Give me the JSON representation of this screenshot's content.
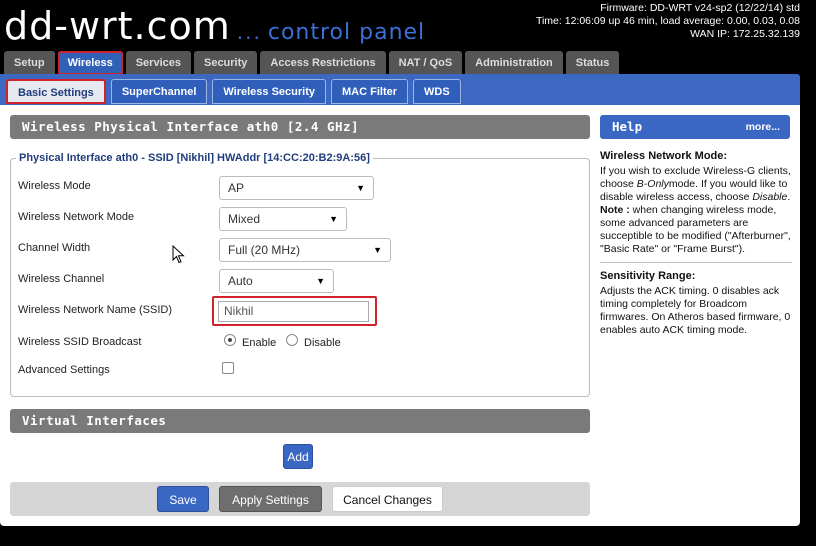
{
  "header": {
    "logo_main": "dd-wrt.com",
    "logo_dots": "...",
    "logo_sub": "control panel",
    "firmware": "Firmware: DD-WRT v24-sp2 (12/22/14) std",
    "time": "Time: 12:06:09 up 46 min, load average: 0.00, 0.03, 0.08",
    "wan_ip": "WAN IP: 172.25.32.139"
  },
  "main_tabs": [
    "Setup",
    "Wireless",
    "Services",
    "Security",
    "Access Restrictions",
    "NAT / QoS",
    "Administration",
    "Status"
  ],
  "sub_tabs": [
    "Basic Settings",
    "SuperChannel",
    "Wireless Security",
    "MAC Filter",
    "WDS"
  ],
  "physical": {
    "section_title": "Wireless Physical Interface ath0 [2.4 GHz]",
    "legend": "Physical Interface ath0 - SSID [Nikhil] HWAddr [14:CC:20:B2:9A:56]",
    "wireless_mode_label": "Wireless Mode",
    "wireless_mode_value": "AP",
    "network_mode_label": "Wireless Network Mode",
    "network_mode_value": "Mixed",
    "channel_width_label": "Channel Width",
    "channel_width_value": "Full (20 MHz)",
    "channel_label": "Wireless Channel",
    "channel_value": "Auto",
    "ssid_label": "Wireless Network Name (SSID)",
    "ssid_value": "Nikhil",
    "broadcast_label": "Wireless SSID Broadcast",
    "enable_label": "Enable",
    "disable_label": "Disable",
    "advanced_label": "Advanced Settings"
  },
  "virtual": {
    "section_title": "Virtual Interfaces",
    "add_label": "Add"
  },
  "footer": {
    "save": "Save",
    "apply": "Apply Settings",
    "cancel": "Cancel Changes"
  },
  "help": {
    "title": "Help",
    "more": "more...",
    "mode_heading": "Wireless Network Mode:",
    "mode_text_1": "If you wish to exclude Wireless-G clients, choose",
    "mode_text_bonly": "B-Only",
    "mode_text_2": "mode. If you would like to disable wireless access, choose",
    "mode_text_disable": "Disable",
    "mode_text_3": ".",
    "note_label": "Note :",
    "note_text": "when changing wireless mode, some advanced parameters are succeptible to be modified (\"Afterburner\", \"Basic Rate\" or \"Frame Burst\").",
    "sens_heading": "Sensitivity Range:",
    "sens_text": "Adjusts the ACK timing. 0 disables ack timing completely for Broadcom firmwares. On Atheros based firmware, 0 enables auto ACK timing mode."
  }
}
